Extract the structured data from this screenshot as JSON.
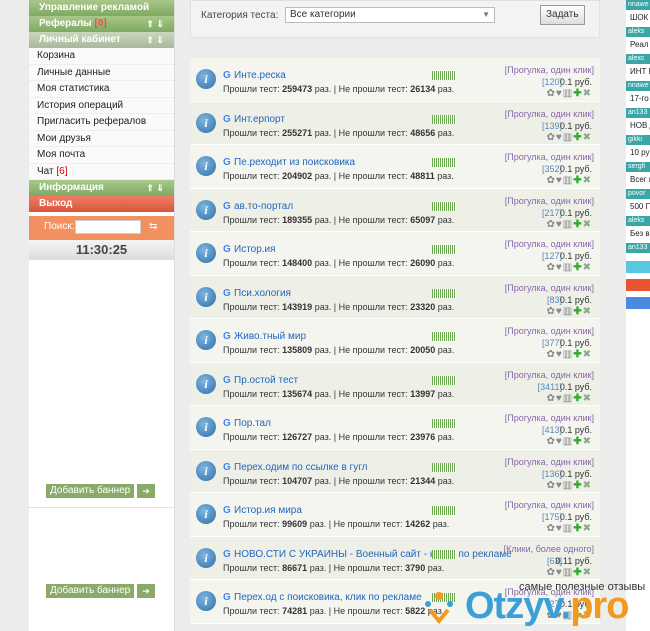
{
  "sidebar": {
    "ads_mgmt": "Управление рекламой",
    "referrals": "Рефералы",
    "referrals_count": "[0]",
    "cabinet": "Личный кабинет",
    "items": [
      {
        "label": "Корзина"
      },
      {
        "label": "Личные данные"
      },
      {
        "label": "Моя статистика"
      },
      {
        "label": "История операций"
      },
      {
        "label": "Пригласить рефералов"
      },
      {
        "label": "Мои друзья"
      },
      {
        "label": "Моя почта"
      },
      {
        "label": "Чат",
        "count": "[6]"
      }
    ],
    "info": "Информация",
    "logout": "Выход",
    "search_label": "Поиск:",
    "clock": "11:30:25",
    "add_banner_1": "Добавить баннер",
    "add_banner_2": "Добавить баннер"
  },
  "filter": {
    "label": "Категория теста:",
    "selected": "Все категории",
    "submit": "Задать"
  },
  "tests": [
    {
      "name": "Инте.реска",
      "passed": "259473",
      "failed": "26134",
      "category": "[Прогулка, один клик]",
      "count": "[120]",
      "price": "0.1 руб."
    },
    {
      "name": "Инт.ерпорт",
      "passed": "255271",
      "failed": "48656",
      "category": "[Прогулка, один клик]",
      "count": "[139]",
      "price": "0.1 руб."
    },
    {
      "name": "Пе.реходит из поисковика",
      "passed": "204902",
      "failed": "48811",
      "category": "[Прогулка, один клик]",
      "count": "[352]",
      "price": "0.1 руб."
    },
    {
      "name": "ав.то-портал",
      "passed": "189355",
      "failed": "65097",
      "category": "[Прогулка, один клик]",
      "count": "[217]",
      "price": "0.1 руб."
    },
    {
      "name": "Истор.ия",
      "passed": "148400",
      "failed": "26090",
      "category": "[Прогулка, один клик]",
      "count": "[127]",
      "price": "0.1 руб."
    },
    {
      "name": "Пси.хология",
      "passed": "143919",
      "failed": "23320",
      "category": "[Прогулка, один клик]",
      "count": "[83]",
      "price": "0.1 руб."
    },
    {
      "name": "Живо.тный мир",
      "passed": "135809",
      "failed": "20050",
      "category": "[Прогулка, один клик]",
      "count": "[377]",
      "price": "0.1 руб."
    },
    {
      "name": "Пр.остой тест",
      "passed": "135674",
      "failed": "13997",
      "category": "[Прогулка, один клик]",
      "count": "[3411]",
      "price": "0.1 руб."
    },
    {
      "name": "Пор.тал",
      "passed": "126727",
      "failed": "23976",
      "category": "[Прогулка, один клик]",
      "count": "[413]",
      "price": "0.1 руб."
    },
    {
      "name": "Перех.одим по ссылке в гугл",
      "passed": "104707",
      "failed": "21344",
      "category": "[Прогулка, один клик]",
      "count": "[136]",
      "price": "0.1 руб."
    },
    {
      "name": "Истор.ия мира",
      "passed": "99609",
      "failed": "14262",
      "category": "[Прогулка, один клик]",
      "count": "[175]",
      "price": "0.1 руб."
    },
    {
      "name": "НОВО.СТИ С УКРАИНЫ - Военный сайт - клики по рекламе",
      "passed": "86671",
      "failed": "3790",
      "category": "[Клики, более одного]",
      "count": "[63]",
      "price": "0.11 руб."
    },
    {
      "name": "Перех.од с поисковика, клик по рекламе",
      "passed": "74281",
      "failed": "5822",
      "category": "[Прогулка, один клик]",
      "count": "[27]",
      "price": "0.1 руб."
    }
  ],
  "labels": {
    "passed_prefix": "Прошли тест:",
    "times": "раз.",
    "failed_prefix": "| Не прошли тест:"
  },
  "right_panel": [
    {
      "user": "nnawe",
      "text": "ШОК ВСЕХ"
    },
    {
      "user": "aleks",
      "text": "Реал зара"
    },
    {
      "user": "alexc",
      "text": "ИНТ ИГРА"
    },
    {
      "user": "nnawe",
      "text": "17-го ПЛАТ"
    },
    {
      "user": "an133",
      "text": "НОВ ДВА"
    },
    {
      "user": "gikki",
      "text": "10 ру пере"
    },
    {
      "user": "sergfi",
      "text": "Всег пока"
    },
    {
      "user": "povor",
      "text": "500 ПРИ СТАВ"
    },
    {
      "user": "aleks",
      "text": "Без в стар"
    },
    {
      "user": "an133",
      "text": ""
    }
  ],
  "watermark": {
    "tagline": "самые полезные отзывы",
    "logo_main": "Otzyv.",
    "logo_tail": "pro"
  }
}
